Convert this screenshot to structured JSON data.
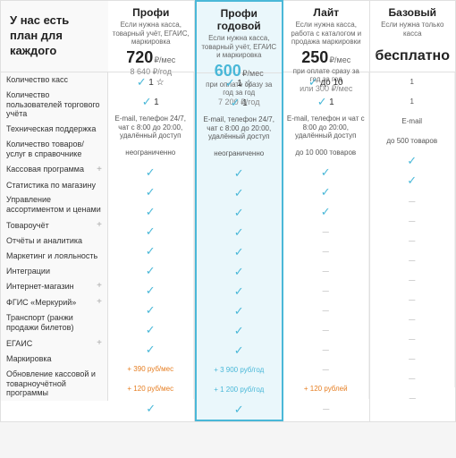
{
  "leftHeader": "У нас есть план для каждого",
  "plans": [
    {
      "id": "profi",
      "name": "Профи",
      "desc": "Если нужна касса, товарный учёт, ЕГАИС, маркировка",
      "priceMonthly": "720",
      "priceUnit": "₽/мес",
      "priceAnnual": "8 640 ₽/год",
      "priceNote": "",
      "highlighted": false
    },
    {
      "id": "profi-annual",
      "name": "Профи годовой",
      "desc": "Если нужна касса, товарный учёт, ЕГАИС и маркировка",
      "priceMonthly": "600",
      "priceUnit": "₽/мес",
      "priceAnnual": "7 200 ₽/год",
      "priceNote": "при оплате сразу за год",
      "highlighted": true
    },
    {
      "id": "lite",
      "name": "Лайт",
      "desc": "Если нужна касса, работа с каталогом и продажа маркировки",
      "priceMonthly": "250",
      "priceUnit": "₽/мес",
      "priceAnnual": "или 300 ₽/мес",
      "priceNote": "при оплате сразу за год",
      "highlighted": false
    },
    {
      "id": "basic",
      "name": "Базовый",
      "desc": "Если нужна только касса",
      "priceMonthly": "бесплатно",
      "priceUnit": "",
      "priceAnnual": "",
      "priceNote": "",
      "highlighted": false,
      "free": true
    }
  ],
  "rows": [
    {
      "label": "Количество касс",
      "expandable": false,
      "cells": [
        "✓ 1 ☆",
        "✓ 1 ☆",
        "✓ до 10",
        "1"
      ]
    },
    {
      "label": "Количество пользователей торгового учёта",
      "expandable": false,
      "cells": [
        "✓ 1",
        "✓ 1",
        "✓ 1",
        "1"
      ]
    },
    {
      "label": "Техническая поддержка",
      "expandable": false,
      "cells": [
        "E-mail, телефон 24/7, чат с 8:00 до 20:00, удалённый доступ",
        "E-mail, телефон 24/7, чат с 8:00 до 20:00, удалённый доступ",
        "E-mail, телефон и чат с 8:00 до 20:00, удалённый доступ",
        "E-mail"
      ]
    },
    {
      "label": "Количество товаров/ услуг в справочнике",
      "expandable": false,
      "cells": [
        "неограниченно",
        "неограниченно",
        "до 10 000 товаров",
        "до 500 товаров"
      ]
    },
    {
      "label": "Кассовая программа",
      "expandable": true,
      "cells": [
        "✓",
        "✓",
        "✓",
        "✓"
      ]
    },
    {
      "label": "Статистика по магазину",
      "expandable": false,
      "cells": [
        "✓",
        "✓",
        "✓",
        "✓"
      ]
    },
    {
      "label": "Управление ассортиментом и ценами",
      "expandable": false,
      "cells": [
        "✓",
        "✓",
        "✓",
        "–"
      ]
    },
    {
      "label": "Товароучёт",
      "expandable": true,
      "cells": [
        "✓",
        "✓",
        "–",
        "–"
      ]
    },
    {
      "label": "Отчёты и аналитика",
      "expandable": false,
      "cells": [
        "✓",
        "✓",
        "–",
        "–"
      ]
    },
    {
      "label": "Маркетинг и лояльность",
      "expandable": false,
      "cells": [
        "✓",
        "✓",
        "–",
        "–"
      ]
    },
    {
      "label": "Интеграции",
      "expandable": false,
      "cells": [
        "✓",
        "✓",
        "–",
        "–"
      ]
    },
    {
      "label": "Интернет-магазин",
      "expandable": true,
      "cells": [
        "✓",
        "✓",
        "–",
        "–"
      ]
    },
    {
      "label": "ФГИС «Меркурий»",
      "expandable": true,
      "cells": [
        "✓",
        "✓",
        "–",
        "–"
      ]
    },
    {
      "label": "Транспорт (ранжи продажи билетов)",
      "expandable": false,
      "cells": [
        "✓",
        "✓",
        "–",
        "–"
      ]
    },
    {
      "label": "ЕГАИС",
      "expandable": true,
      "cells": [
        "+ 390 руб/мес",
        "+ 3 900 руб/год",
        "–",
        "–"
      ]
    },
    {
      "label": "Маркировка",
      "expandable": false,
      "cells": [
        "+ 120 руб/мес",
        "+ 1 200 руб/год",
        "+ 120 рублей",
        "–"
      ]
    },
    {
      "label": "Обновление кассовой и товарноучётной программы",
      "expandable": false,
      "cells": [
        "✓",
        "✓",
        "–",
        "–"
      ]
    }
  ]
}
